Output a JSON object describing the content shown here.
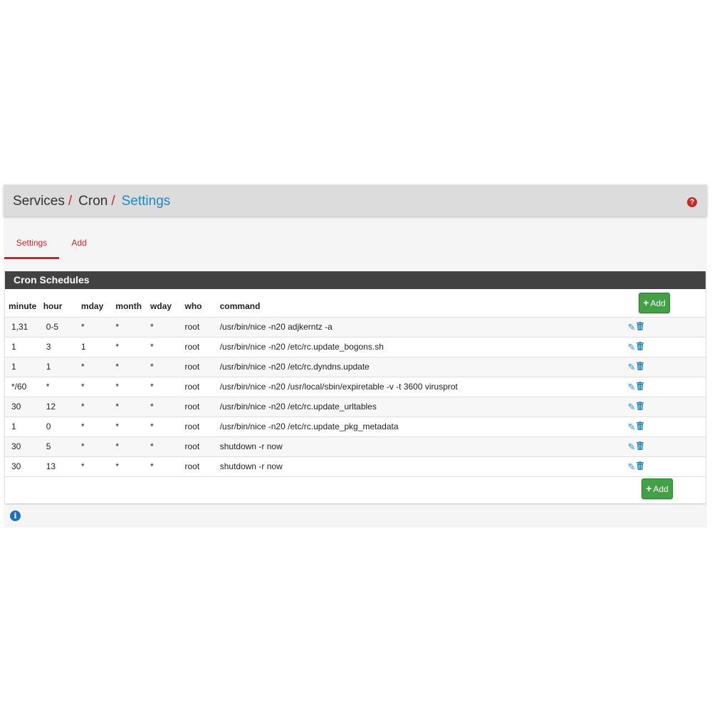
{
  "breadcrumb": {
    "items": [
      "Services",
      "Cron",
      "Settings"
    ],
    "separator": "/"
  },
  "help_icon": "question-circle-icon",
  "tabs": [
    {
      "label": "Settings",
      "active": true
    },
    {
      "label": "Add",
      "active": false
    }
  ],
  "panel": {
    "title": "Cron Schedules",
    "add_label": "Add",
    "columns": [
      "minute",
      "hour",
      "mday",
      "month",
      "wday",
      "who",
      "command"
    ],
    "rows": [
      {
        "minute": "1,31",
        "hour": "0-5",
        "mday": "*",
        "month": "*",
        "wday": "*",
        "who": "root",
        "command": "/usr/bin/nice -n20 adjkerntz -a"
      },
      {
        "minute": "1",
        "hour": "3",
        "mday": "1",
        "month": "*",
        "wday": "*",
        "who": "root",
        "command": "/usr/bin/nice -n20 /etc/rc.update_bogons.sh"
      },
      {
        "minute": "1",
        "hour": "1",
        "mday": "*",
        "month": "*",
        "wday": "*",
        "who": "root",
        "command": "/usr/bin/nice -n20 /etc/rc.dyndns.update"
      },
      {
        "minute": "*/60",
        "hour": "*",
        "mday": "*",
        "month": "*",
        "wday": "*",
        "who": "root",
        "command": "/usr/bin/nice -n20 /usr/local/sbin/expiretable -v -t 3600 virusprot"
      },
      {
        "minute": "30",
        "hour": "12",
        "mday": "*",
        "month": "*",
        "wday": "*",
        "who": "root",
        "command": "/usr/bin/nice -n20 /etc/rc.update_urltables"
      },
      {
        "minute": "1",
        "hour": "0",
        "mday": "*",
        "month": "*",
        "wday": "*",
        "who": "root",
        "command": "/usr/bin/nice -n20 /etc/rc.update_pkg_metadata"
      },
      {
        "minute": "30",
        "hour": "5",
        "mday": "*",
        "month": "*",
        "wday": "*",
        "who": "root",
        "command": "shutdown -r now"
      },
      {
        "minute": "30",
        "hour": "13",
        "mday": "*",
        "month": "*",
        "wday": "*",
        "who": "root",
        "command": "shutdown -r now"
      }
    ],
    "row_action_icons": [
      "pencil-icon",
      "trash-icon"
    ]
  },
  "info_icon": "info-circle-icon",
  "colors": {
    "accent_red": "#c62828",
    "link_blue": "#1e88c7",
    "add_green": "#43a047",
    "panel_heading": "#424242"
  }
}
